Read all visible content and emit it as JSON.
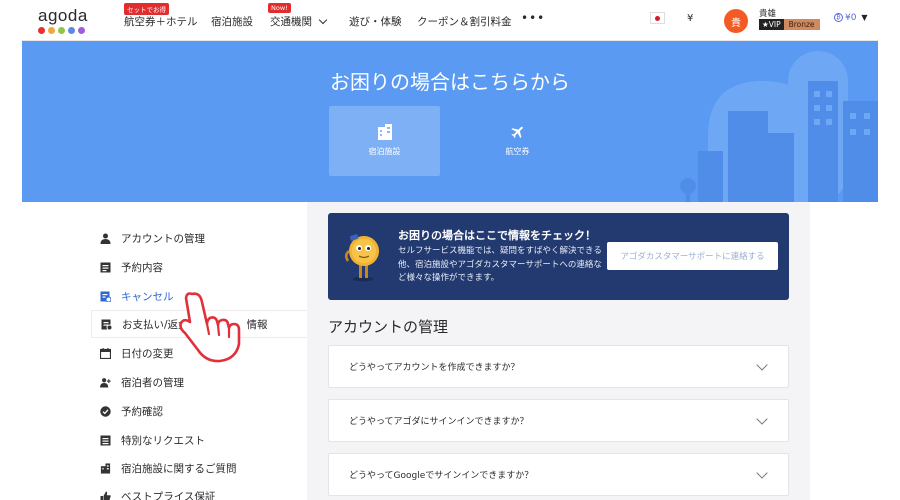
{
  "header": {
    "logo_text": "agoda",
    "logo_dot_colors": [
      "#e5312f",
      "#f3a73a",
      "#8ec646",
      "#5a88e5",
      "#a25be0"
    ],
    "nav": [
      {
        "label": "航空券＋ホテル",
        "badge": "セットでお得"
      },
      {
        "label": "宿泊施設",
        "badge": ""
      },
      {
        "label": "交通機関",
        "badge": "Now!"
      },
      {
        "label": "遊び・体験",
        "badge": ""
      },
      {
        "label": "クーポン＆割引料金",
        "badge": ""
      }
    ],
    "more_label": "•••",
    "currency_symbol": "¥",
    "avatar_initial": "貴",
    "user_name": "貴雄",
    "vip_label": "★VIP",
    "tier_label": "Bronze",
    "points_value": "¥0",
    "dropdown_arrow": "▼",
    "chevron": "⌄"
  },
  "banner": {
    "title": "お困りの場合はこちらから",
    "tiles": [
      {
        "label": "宿泊施設",
        "icon": "building-icon",
        "active": true
      },
      {
        "label": "航空券",
        "icon": "airplane-icon",
        "active": false
      }
    ]
  },
  "sidebar": {
    "items": [
      {
        "label": "アカウントの管理",
        "icon": "person-icon"
      },
      {
        "label": "予約内容",
        "icon": "document-icon"
      },
      {
        "label": "キャンセル",
        "icon": "cancel-doc-icon"
      },
      {
        "label": "お支払い/返金",
        "icon": "payment-doc-icon"
      },
      {
        "label": "日付の変更",
        "icon": "calendar-icon"
      },
      {
        "label": "宿泊者の管理",
        "icon": "guest-add-icon"
      },
      {
        "label": "予約確認",
        "icon": "check-circle-icon"
      },
      {
        "label": "特別なリクエスト",
        "icon": "request-doc-icon"
      },
      {
        "label": "宿泊施設に関するご質問",
        "icon": "property-icon"
      },
      {
        "label": "ベストプライス保証",
        "icon": "thumbs-up-icon"
      }
    ],
    "partial_label_tail": "情報"
  },
  "main": {
    "info_card": {
      "title": "お困りの場合はここで情報をチェック！",
      "text": "セルフサービス機能では、疑問をすばやく解決できる他、宿泊施設やアゴダカスタマーサポートへの連絡など様々な操作ができます。",
      "button_label": "アゴダカスタマーサポートに連絡する"
    },
    "section_title": "アカウントの管理",
    "faqs": [
      {
        "question": "どうやってアカウントを作成できますか？"
      },
      {
        "question": "どうやってアゴダにサインインできますか？"
      },
      {
        "question": "どうやってGoogleでサインインできますか？"
      }
    ]
  },
  "colors": {
    "banner_blue": "#5a9af2",
    "card_navy": "#233a70",
    "accent_red": "#e12d2d",
    "link_blue": "#2e68d6",
    "hand_red": "#e0303a"
  }
}
